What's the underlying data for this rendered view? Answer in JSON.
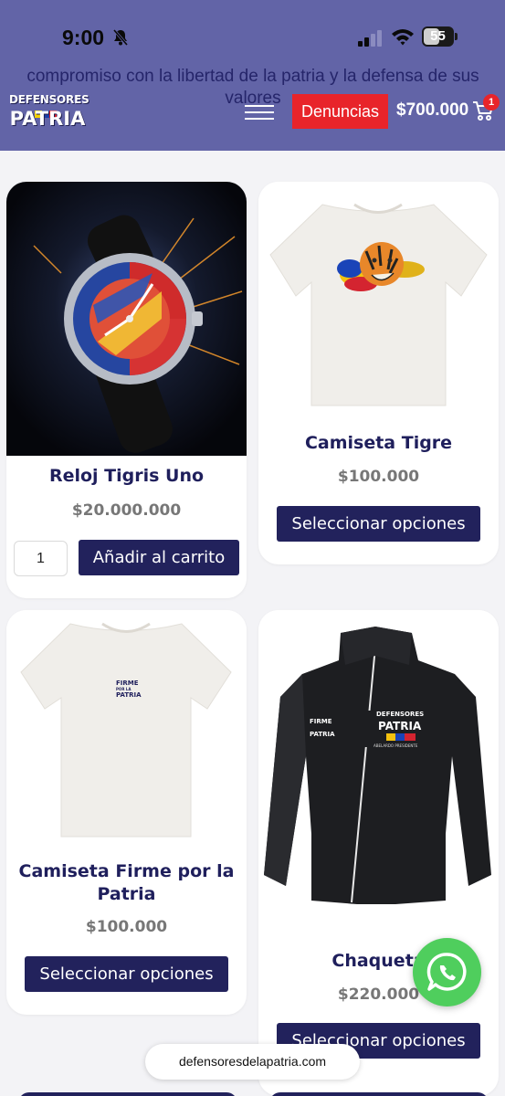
{
  "status_bar": {
    "time": "9:00",
    "battery": "55"
  },
  "header": {
    "tagline": "compromiso con la libertad de la patria y la defensa de sus valores",
    "logo_top": "DEFENSORES",
    "logo_bottom": "PATRIA",
    "denuncias_label": "Denuncias",
    "cart_total": "$700.000",
    "cart_count": "1"
  },
  "products": [
    {
      "title": "Reloj Tigris Uno",
      "price": "$20.000.000",
      "quantity": "1",
      "button": "Añadir al carrito"
    },
    {
      "title": "Camiseta Tigre",
      "price": "$100.000",
      "button": "Seleccionar opciones"
    },
    {
      "title": "Camiseta Firme por la Patria",
      "price": "$100.000",
      "button": "Seleccionar opciones"
    },
    {
      "title": "Chaqueta",
      "price": "$220.000",
      "button": "Seleccionar opciones"
    }
  ],
  "product_art": {
    "shirt_print_line1": "FIRME",
    "shirt_print_line2": "POR LA",
    "shirt_print_line3": "PATRIA",
    "jacket_logo_top": "DEFENSORES",
    "jacket_logo_bottom": "PATRIA",
    "jacket_subtitle": "ABELARDO PRESIDENTE"
  },
  "browser": {
    "url": "defensoresdelapatria.com"
  },
  "colors": {
    "header_bg": "#6264a7",
    "accent_navy": "#22225c",
    "denuncias_red": "#e8242a",
    "whatsapp_green": "#4fce5d"
  }
}
